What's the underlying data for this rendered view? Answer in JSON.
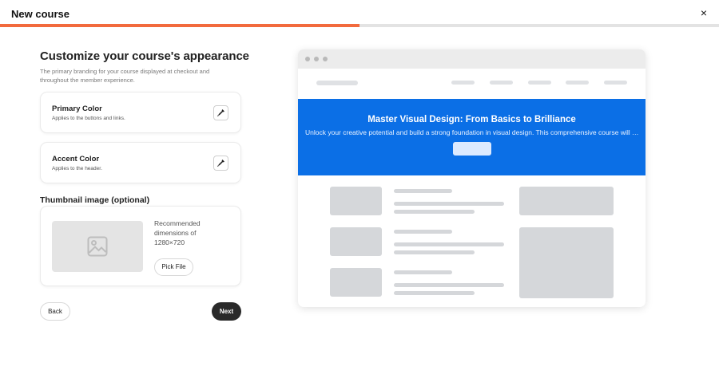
{
  "window": {
    "title": "New course",
    "close_icon": "×",
    "progress_fraction": 0.5
  },
  "colors": {
    "accent": "#f26a3d",
    "preview_header": "#0b6fe6",
    "next_button": "#2a2a2a"
  },
  "form": {
    "heading": "Customize your course's appearance",
    "description": "The primary branding for your course displayed at checkout and throughout the member experience.",
    "primary_color": {
      "title": "Primary Color",
      "subtitle": "Applies to the buttons and links.",
      "icon": "eyedropper-icon"
    },
    "accent_color": {
      "title": "Accent Color",
      "subtitle": "Applies to the header.",
      "icon": "eyedropper-icon"
    },
    "thumbnail": {
      "label": "Thumbnail image (optional)",
      "recommendation": "Recommended dimensions of 1280×720",
      "pick_label": "Pick File",
      "placeholder_icon": "image-icon"
    },
    "back_label": "Back",
    "next_label": "Next"
  },
  "preview": {
    "hero_title": "Master Visual Design: From Basics to Brilliance",
    "hero_subtitle": "Unlock your creative potential and build a strong foundation in visual design. This comprehensive course will guide you through the essentials."
  }
}
